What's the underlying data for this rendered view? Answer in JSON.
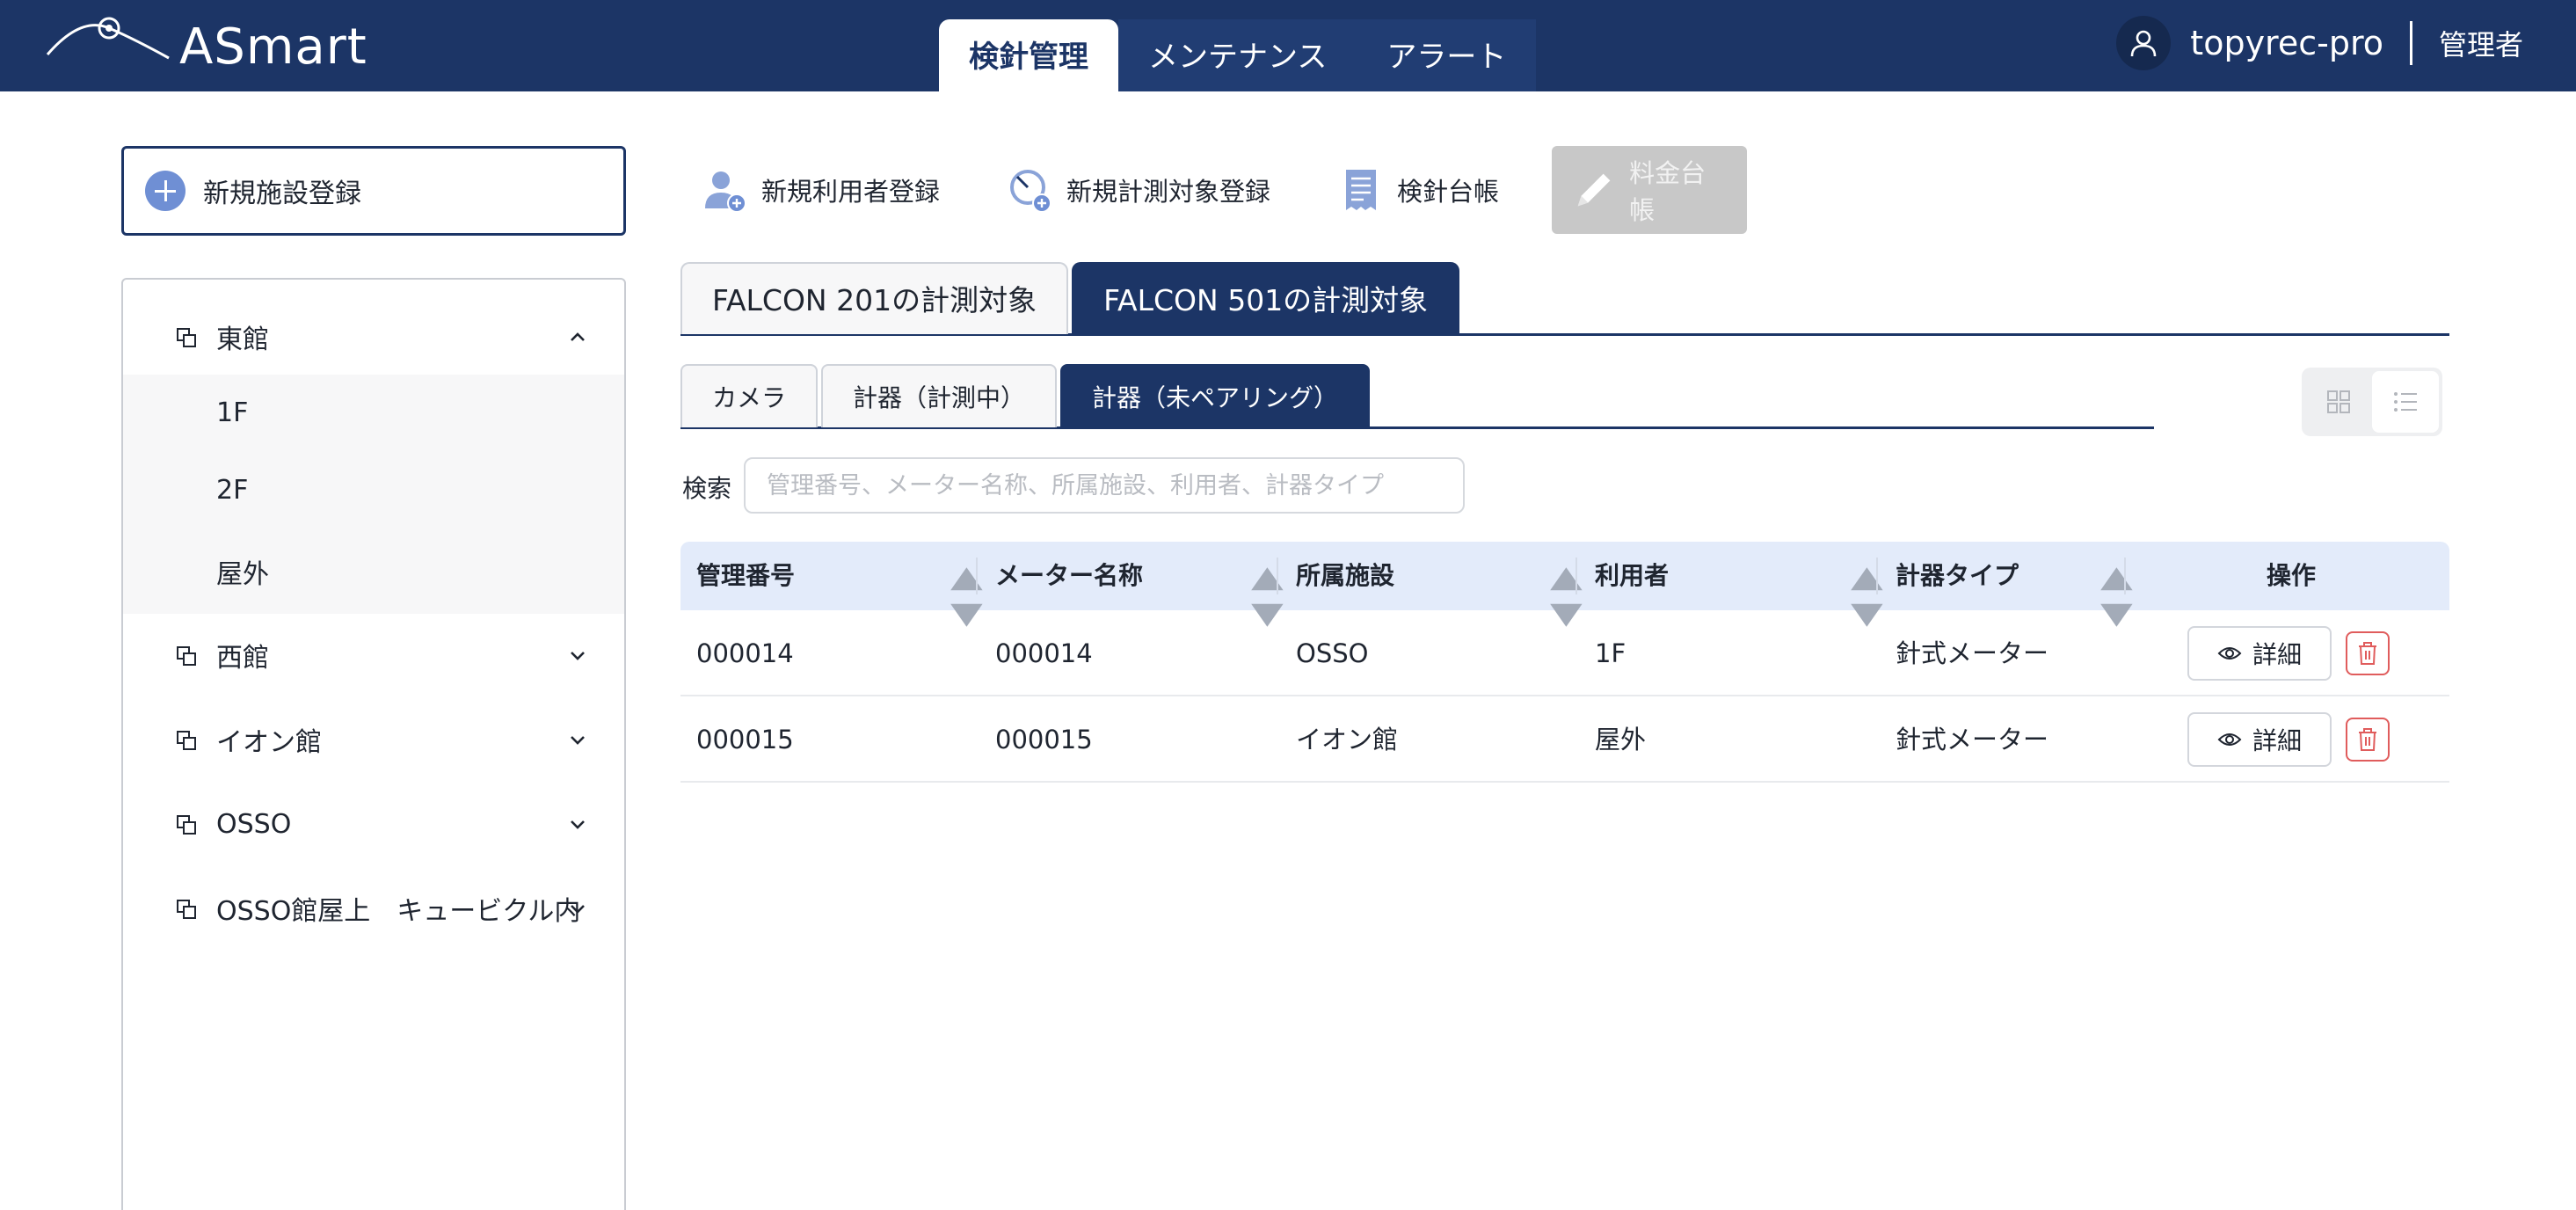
{
  "header": {
    "logo_text": "ASmart",
    "nav": [
      {
        "label": "検針管理",
        "active": true
      },
      {
        "label": "メンテナンス",
        "active": false
      },
      {
        "label": "アラート",
        "active": false
      }
    ],
    "username": "topyrec-pro",
    "role": "管理者"
  },
  "sidebar": {
    "new_facility_label": "新規施設登録",
    "tree": [
      {
        "label": "東館",
        "expanded": true,
        "children": [
          "1F",
          "2F",
          "屋外"
        ]
      },
      {
        "label": "西館",
        "expanded": false
      },
      {
        "label": "イオン館",
        "expanded": false
      },
      {
        "label": "OSSO",
        "expanded": false
      },
      {
        "label": "OSSO館屋上　キュービクル内",
        "expanded": false
      }
    ]
  },
  "toolbar": {
    "new_user": "新規利用者登録",
    "new_target": "新規計測対象登録",
    "ledger": "検針台帳",
    "fee_ledger": "料金台帳"
  },
  "falcon_tabs": [
    {
      "label": "FALCON 201の計測対象",
      "active": false
    },
    {
      "label": "FALCON 501の計測対象",
      "active": true
    }
  ],
  "sub_tabs": [
    {
      "label": "カメラ",
      "active": false
    },
    {
      "label": "計器（計測中）",
      "active": false
    },
    {
      "label": "計器（未ペアリング）",
      "active": true
    }
  ],
  "view_toggle": {
    "active": "list"
  },
  "search": {
    "label": "検索",
    "placeholder": "管理番号、メーター名称、所属施設、利用者、計器タイプ",
    "value": ""
  },
  "table": {
    "columns": [
      "管理番号",
      "メーター名称",
      "所属施設",
      "利用者",
      "計器タイプ",
      "操作"
    ],
    "rows": [
      [
        "000014",
        "000014",
        "OSSO",
        "1F",
        "針式メーター"
      ],
      [
        "000015",
        "000015",
        "イオン館",
        "屋外",
        "針式メーター"
      ]
    ],
    "detail_label": "詳細"
  },
  "colors": {
    "header_bg": "#1c3566",
    "table_header_bg": "#e3ebfa",
    "danger": "#e05c5c",
    "disabled": "#c8c8c8"
  }
}
